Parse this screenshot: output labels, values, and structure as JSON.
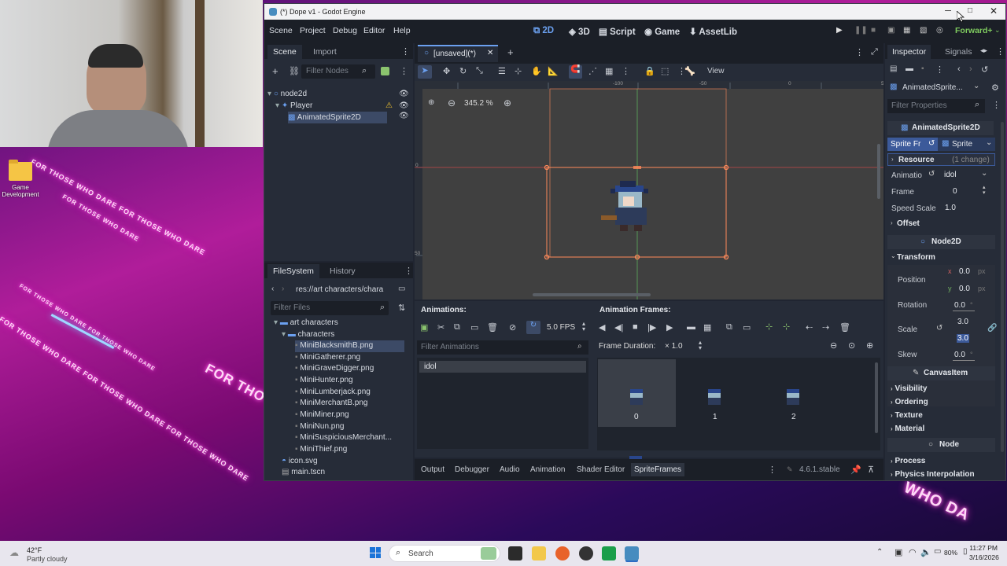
{
  "desktop": {
    "icon_label_line1": "Game",
    "icon_label_line2": "Development",
    "neon_text": [
      "FOR THOSE WHO DARE FOR THOSE WHO DARE",
      "FOR THOSE WHO DARE",
      "FOR THOSE WHO DARE FOR THOSE WHO DARE",
      "FOR THOSE WHO DARE FOR THOSE WHO DARE FOR THOSE WHO DARE",
      "FOR THO",
      "WHO DA"
    ]
  },
  "window": {
    "title": "(*) Dope v1 - Godot Engine",
    "menus": [
      "Scene",
      "Project",
      "Debug",
      "Editor",
      "Help"
    ],
    "workspaces": [
      "2D",
      "3D",
      "Script",
      "Game",
      "AssetLib"
    ],
    "renderer": "Forward+"
  },
  "scene_dock": {
    "tabs": [
      "Scene",
      "Import"
    ],
    "filter_placeholder": "Filter Nodes",
    "nodes": [
      "node2d",
      "Player",
      "AnimatedSprite2D"
    ]
  },
  "filesystem_dock": {
    "tabs": [
      "FileSystem",
      "History"
    ],
    "path": "res://art characters/chara",
    "filter_placeholder": "Filter Files",
    "items": [
      {
        "name": "art characters",
        "kind": "folder"
      },
      {
        "name": "characters",
        "kind": "folder"
      },
      {
        "name": "MiniBlacksmithB.png",
        "kind": "file"
      },
      {
        "name": "MiniGatherer.png",
        "kind": "file"
      },
      {
        "name": "MiniGraveDigger.png",
        "kind": "file"
      },
      {
        "name": "MiniHunter.png",
        "kind": "file"
      },
      {
        "name": "MiniLumberjack.png",
        "kind": "file"
      },
      {
        "name": "MiniMerchantB.png",
        "kind": "file"
      },
      {
        "name": "MiniMiner.png",
        "kind": "file"
      },
      {
        "name": "MiniNun.png",
        "kind": "file"
      },
      {
        "name": "MiniSuspiciousMerchant...",
        "kind": "file"
      },
      {
        "name": "MiniThief.png",
        "kind": "file"
      },
      {
        "name": "icon.svg",
        "kind": "file"
      },
      {
        "name": "main.tscn",
        "kind": "file"
      }
    ]
  },
  "editor": {
    "tab_label": "[unsaved](*)",
    "view_menu": "View",
    "zoom": "345.2 %",
    "ruler_h": [
      "-100",
      "-50",
      "0",
      "50",
      "100"
    ],
    "ruler_v": [
      "0",
      "50"
    ]
  },
  "sprite_frames": {
    "animations_title": "Animations:",
    "fps": "5.0 FPS",
    "filter_placeholder": "Filter Animations",
    "animations": [
      "idol"
    ],
    "frames_title": "Animation Frames:",
    "frame_duration_label": "Frame Duration:",
    "frame_duration_value": "× 1.0",
    "frames": [
      "0",
      "1",
      "2"
    ]
  },
  "bottom_panel": {
    "tabs": [
      "Output",
      "Debugger",
      "Audio",
      "Animation",
      "Shader Editor",
      "SpriteFrames"
    ],
    "version": "4.6.1.stable"
  },
  "inspector": {
    "tabs": [
      "Inspector",
      "Signals"
    ],
    "node_selector": "AnimatedSprite...",
    "filter_placeholder": "Filter Properties",
    "class_header": "AnimatedSprite2D",
    "sprite_frames_label": "Sprite Fr",
    "sprite_frames_value": "Sprite",
    "resource_label": "Resource",
    "resource_note": "(1 change)",
    "animation_label": "Animatio",
    "animation_value": "idol",
    "frame_label": "Frame",
    "frame_value": "0",
    "speed_label": "Speed Scale",
    "speed_value": "1.0",
    "offset_label": "Offset",
    "node2d_header": "Node2D",
    "transform_label": "Transform",
    "position_label": "Position",
    "pos_x_axis": "x",
    "pos_x": "0.0",
    "pos_y_axis": "y",
    "pos_y": "0.0",
    "unit_px": "px",
    "rotation_label": "Rotation",
    "rotation_value": "0.0",
    "degree": "°",
    "scale_label": "Scale",
    "scale_x": "3.0",
    "scale_y": "3.0",
    "skew_label": "Skew",
    "skew_value": "0.0",
    "canvasitem_header": "CanvasItem",
    "visibility_label": "Visibility",
    "ordering_label": "Ordering",
    "texture_label": "Texture",
    "material_label": "Material",
    "node_header": "Node",
    "process_label": "Process",
    "physics_label": "Physics Interpolation"
  },
  "taskbar": {
    "weather_temp": "42°F",
    "weather_desc": "Partly cloudy",
    "search": "Search",
    "battery": "80%",
    "time": "11:27 PM",
    "date": "3/16/2026"
  },
  "colors": {
    "accent": "#6ba0f0",
    "selection": "#3c4a66",
    "renderer": "#7fcb5f",
    "warn": "#f2c530",
    "selection_box": "#ff8a5a"
  }
}
